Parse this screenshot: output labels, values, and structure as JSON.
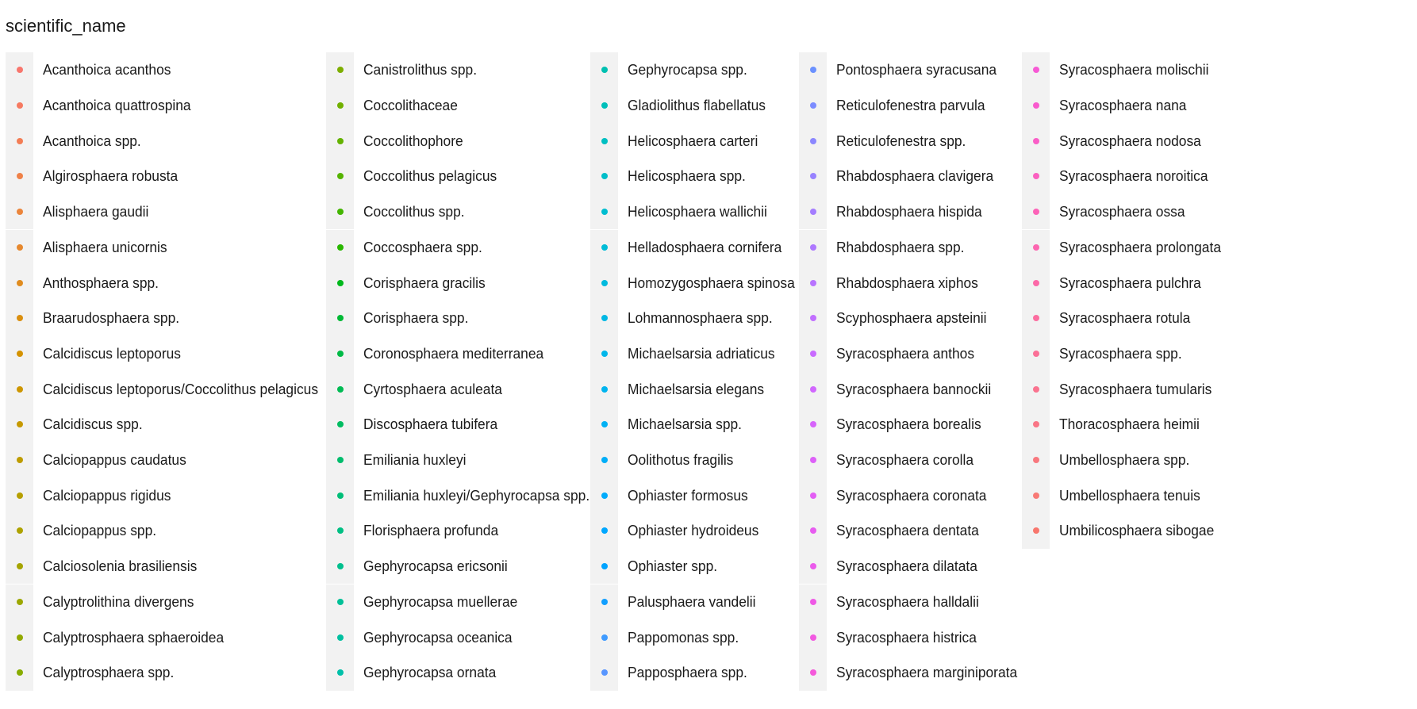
{
  "chart_data": {
    "type": "scatter",
    "legend": {
      "title": "scientific_name",
      "columns": 5,
      "entries": [
        {
          "label": "Acanthoica acanthos",
          "color": "#F8766D"
        },
        {
          "label": "Acanthoica quattrospina",
          "color": "#F67A61"
        },
        {
          "label": "Acanthoica spp.",
          "color": "#F37D55"
        },
        {
          "label": "Algirosphaera robusta",
          "color": "#EF8148"
        },
        {
          "label": "Alisphaera gaudii",
          "color": "#EB853B"
        },
        {
          "label": "Alisphaera unicornis",
          "color": "#E6882E"
        },
        {
          "label": "Anthosphaera spp.",
          "color": "#E08C1F"
        },
        {
          "label": "Braarudosphaera spp.",
          "color": "#DA8F0F"
        },
        {
          "label": "Calcidiscus leptoporus",
          "color": "#D49200"
        },
        {
          "label": "Calcidiscus leptoporus/Coccolithus pelagicus",
          "color": "#CD9600"
        },
        {
          "label": "Calcidiscus spp.",
          "color": "#C69900"
        },
        {
          "label": "Calciopappus caudatus",
          "color": "#BE9C00"
        },
        {
          "label": "Calciopappus rigidus",
          "color": "#B69F00"
        },
        {
          "label": "Calciopappus spp.",
          "color": "#AEA200"
        },
        {
          "label": "Calciosolenia brasiliensis",
          "color": "#A5A400"
        },
        {
          "label": "Calyptrolithina divergens",
          "color": "#9CA700"
        },
        {
          "label": "Calyptrosphaera sphaeroidea",
          "color": "#92A900"
        },
        {
          "label": "Calyptrosphaera spp.",
          "color": "#88AC00"
        },
        {
          "label": "Canistrolithus spp.",
          "color": "#7DAE00"
        },
        {
          "label": "Coccolithaceae",
          "color": "#71B000"
        },
        {
          "label": "Coccolithophore",
          "color": "#64B200"
        },
        {
          "label": "Coccolithus pelagicus",
          "color": "#55B300"
        },
        {
          "label": "Coccolithus spp.",
          "color": "#43B500"
        },
        {
          "label": "Coccosphaera spp.",
          "color": "#29B700"
        },
        {
          "label": "Corisphaera gracilis",
          "color": "#00B81C"
        },
        {
          "label": "Corisphaera spp.",
          "color": "#00B935"
        },
        {
          "label": "Coronosphaera mediterranea",
          "color": "#00BA46"
        },
        {
          "label": "Cyrtosphaera aculeata",
          "color": "#00BB54"
        },
        {
          "label": "Discosphaera tubifera",
          "color": "#00BC61"
        },
        {
          "label": "Emiliania huxleyi",
          "color": "#00BD6D"
        },
        {
          "label": "Emiliania huxleyi/Gephyrocapsa spp.",
          "color": "#00BE78"
        },
        {
          "label": "Florisphaera profunda",
          "color": "#00BF83"
        },
        {
          "label": "Gephyrocapsa ericsonii",
          "color": "#00BF8D"
        },
        {
          "label": "Gephyrocapsa muellerae",
          "color": "#00C097"
        },
        {
          "label": "Gephyrocapsa oceanica",
          "color": "#00C0A0"
        },
        {
          "label": "Gephyrocapsa ornata",
          "color": "#00C0A9"
        },
        {
          "label": "Gephyrocapsa spp.",
          "color": "#00C0B1"
        },
        {
          "label": "Gladiolithus flabellatus",
          "color": "#00BFBA"
        },
        {
          "label": "Helicosphaera carteri",
          "color": "#00BFC2"
        },
        {
          "label": "Helicosphaera spp.",
          "color": "#00BEC9"
        },
        {
          "label": "Helicosphaera wallichii",
          "color": "#00BDD0"
        },
        {
          "label": "Helladosphaera cornifera",
          "color": "#00BCD7"
        },
        {
          "label": "Homozygosphaera spinosa",
          "color": "#00BADE"
        },
        {
          "label": "Lohmannosphaera spp.",
          "color": "#00B8E4"
        },
        {
          "label": "Michaelsarsia adriaticus",
          "color": "#00B6EA"
        },
        {
          "label": "Michaelsarsia elegans",
          "color": "#00B4EF"
        },
        {
          "label": "Michaelsarsia spp.",
          "color": "#00B1F4"
        },
        {
          "label": "Oolithotus fragilis",
          "color": "#00AEF8"
        },
        {
          "label": "Ophiaster formosus",
          "color": "#00ABFC"
        },
        {
          "label": "Ophiaster hydroideus",
          "color": "#00A7FF"
        },
        {
          "label": "Ophiaster spp.",
          "color": "#00A3FF"
        },
        {
          "label": "Palusphaera vandelii",
          "color": "#129FFF"
        },
        {
          "label": "Pappomonas spp.",
          "color": "#3F9BFF"
        },
        {
          "label": "Papposphaera spp.",
          "color": "#5896FF"
        },
        {
          "label": "Pontosphaera syracusana",
          "color": "#6B91FF"
        },
        {
          "label": "Reticulofenestra parvula",
          "color": "#7C8CFF"
        },
        {
          "label": "Reticulofenestra spp.",
          "color": "#8B87FF"
        },
        {
          "label": "Rhabdosphaera clavigera",
          "color": "#9882FF"
        },
        {
          "label": "Rhabdosphaera hispida",
          "color": "#A47DFF"
        },
        {
          "label": "Rhabdosphaera spp.",
          "color": "#AE78FF"
        },
        {
          "label": "Rhabdosphaera xiphos",
          "color": "#B874FF"
        },
        {
          "label": "Scyphosphaera apsteinii",
          "color": "#C16FFF"
        },
        {
          "label": "Syracosphaera anthos",
          "color": "#C96BFF"
        },
        {
          "label": "Syracosphaera bannockii",
          "color": "#D167FE"
        },
        {
          "label": "Syracosphaera borealis",
          "color": "#D764FB"
        },
        {
          "label": "Syracosphaera corolla",
          "color": "#DD61F8"
        },
        {
          "label": "Syracosphaera coronata",
          "color": "#E35EF4"
        },
        {
          "label": "Syracosphaera dentata",
          "color": "#E75CF0"
        },
        {
          "label": "Syracosphaera dilatata",
          "color": "#EB5AEB"
        },
        {
          "label": "Syracosphaera halldalii",
          "color": "#EF59E6"
        },
        {
          "label": "Syracosphaera histrica",
          "color": "#F259E1"
        },
        {
          "label": "Syracosphaera marginiporata",
          "color": "#F559DB"
        },
        {
          "label": "Syracosphaera molischii",
          "color": "#F75AD5"
        },
        {
          "label": "Syracosphaera nana",
          "color": "#F95BCE"
        },
        {
          "label": "Syracosphaera nodosa",
          "color": "#FA5EC7"
        },
        {
          "label": "Syracosphaera noroitica",
          "color": "#FB60C0"
        },
        {
          "label": "Syracosphaera ossa",
          "color": "#FC63B8"
        },
        {
          "label": "Syracosphaera prolongata",
          "color": "#FC66B0"
        },
        {
          "label": "Syracosphaera pulchra",
          "color": "#FC69A8"
        },
        {
          "label": "Syracosphaera rotula",
          "color": "#FC6DA0"
        },
        {
          "label": "Syracosphaera spp.",
          "color": "#FB7097"
        },
        {
          "label": "Syracosphaera tumularis",
          "color": "#FA738F"
        },
        {
          "label": "Thoracosphaera heimii",
          "color": "#F97686"
        },
        {
          "label": "Umbellosphaera spp.",
          "color": "#F8787E"
        },
        {
          "label": "Umbellosphaera tenuis",
          "color": "#F87A76"
        },
        {
          "label": "Umbilicosphaera sibogae",
          "color": "#F8766D"
        }
      ]
    }
  }
}
